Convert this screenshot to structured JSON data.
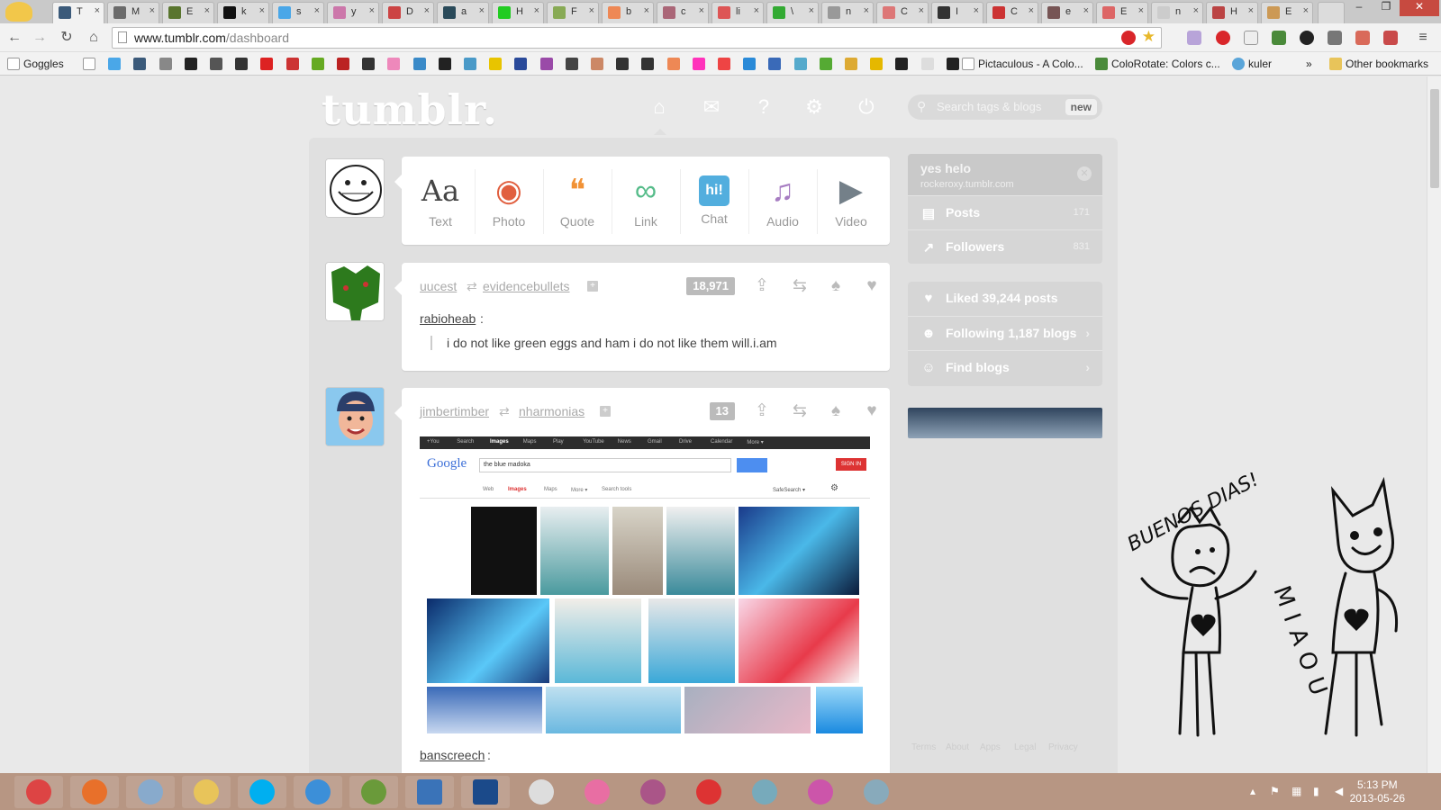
{
  "browser": {
    "tabs": [
      {
        "label": "T",
        "active": true,
        "color": "#3b5a7a"
      },
      {
        "label": "M",
        "color": "#6b6b6b"
      },
      {
        "label": "E",
        "color": "#59752e"
      },
      {
        "label": "k",
        "color": "#111"
      },
      {
        "label": "s",
        "color": "#4aa7e8"
      },
      {
        "label": "y",
        "color": "#c7a"
      },
      {
        "label": "D",
        "color": "#c44"
      },
      {
        "label": "a",
        "color": "#2a4a5a"
      },
      {
        "label": "H",
        "color": "#2c2"
      },
      {
        "label": "F",
        "color": "#8a5"
      },
      {
        "label": "b",
        "color": "#e85"
      },
      {
        "label": "c",
        "color": "#a67"
      },
      {
        "label": "li",
        "color": "#d55"
      },
      {
        "label": "\\",
        "color": "#3a3"
      },
      {
        "label": "n",
        "color": "#999"
      },
      {
        "label": "C",
        "color": "#d77"
      },
      {
        "label": "I",
        "color": "#333"
      },
      {
        "label": "C",
        "color": "#c33"
      },
      {
        "label": "e",
        "color": "#755"
      },
      {
        "label": "E",
        "color": "#d66"
      },
      {
        "label": "n",
        "color": "#ccc"
      },
      {
        "label": "H",
        "color": "#b44"
      },
      {
        "label": "E",
        "color": "#c95"
      }
    ],
    "url_host": "www.tumblr.com",
    "url_path": "/dashboard",
    "window_controls": [
      "–",
      "❐",
      "✕"
    ],
    "menu_icon": "≡",
    "bookmarks": {
      "goggles": "Goggles",
      "pictaculous": "Pictaculous - A Colo...",
      "colorotate": "ColoRotate: Colors c...",
      "kuler": "kuler",
      "more": "»",
      "other": "Other bookmarks"
    }
  },
  "tumblr": {
    "logo": "tumblr.",
    "search_placeholder": "Search tags & blogs",
    "search_new": "new",
    "post_types": [
      {
        "label": "Text",
        "icon": "Aa",
        "color": "#444"
      },
      {
        "label": "Photo",
        "icon": "◉",
        "color": "#e15f3f"
      },
      {
        "label": "Quote",
        "icon": "❝",
        "color": "#f19236"
      },
      {
        "label": "Link",
        "icon": "∞",
        "color": "#56bc8a"
      },
      {
        "label": "Chat",
        "icon": "hi!",
        "color": "#52aede"
      },
      {
        "label": "Audio",
        "icon": "♫",
        "color": "#a77dc2"
      },
      {
        "label": "Video",
        "icon": "▶",
        "color": "#748089"
      }
    ],
    "post1": {
      "user": "uucest",
      "reblogged_from": "evidencebullets",
      "notes": "18,971",
      "source": "rabioheab",
      "source_suffix": ":",
      "quote": "i do not like green eggs and ham i do not like them will.i.am"
    },
    "post2": {
      "user": "jimbertimber",
      "reblogged_from": "nharmonias",
      "notes": "13",
      "source": "banscreech",
      "source_suffix": ":",
      "google": {
        "logo": "Google",
        "query": "the blue madoka",
        "signin": "SIGN IN",
        "topbar": [
          "+You",
          "Search",
          "Images",
          "Maps",
          "Play",
          "YouTube",
          "News",
          "Gmail",
          "Drive",
          "Calendar",
          "More ▾"
        ],
        "tabs": [
          "Web",
          "Images",
          "Maps",
          "More ▾",
          "Search tools"
        ],
        "safe": "SafeSearch ▾"
      }
    },
    "sidebar": {
      "blog_title": "yes helo",
      "blog_url": "rockeroxy.tumblr.com",
      "posts_label": "Posts",
      "posts_count": "171",
      "followers_label": "Followers",
      "followers_count": "831",
      "liked": "Liked 39,244 posts",
      "following": "Following 1,187 blogs",
      "find": "Find blogs"
    },
    "footer_links": [
      "Terms",
      "About",
      "Apps",
      "Legal",
      "Privacy"
    ]
  },
  "taskbar": {
    "time": "5:13 PM",
    "date": "2013-05-26",
    "apps": [
      {
        "name": "chrome",
        "color": "#d44"
      },
      {
        "name": "firefox",
        "color": "#e8702a"
      },
      {
        "name": "paint",
        "color": "#88aacc"
      },
      {
        "name": "explorer",
        "color": "#e8c45a"
      },
      {
        "name": "skype",
        "color": "#00aff0"
      },
      {
        "name": "itunes",
        "color": "#3c8fd8"
      },
      {
        "name": "minecraft",
        "color": "#6a9a3a"
      },
      {
        "name": "photoshop-elements",
        "color": "#3a73b8"
      },
      {
        "name": "photoshop",
        "color": "#1b4a8a"
      },
      {
        "name": "notepad",
        "color": "#ddd"
      },
      {
        "name": "osu",
        "color": "#e86ea3"
      },
      {
        "name": "game-1",
        "color": "#a58"
      },
      {
        "name": "mushroom",
        "color": "#d33"
      },
      {
        "name": "game-2",
        "color": "#7ab"
      },
      {
        "name": "paint-tool",
        "color": "#c5a"
      },
      {
        "name": "control-panel",
        "color": "#8ab"
      }
    ]
  },
  "doodle": {
    "greeting": "BUENOS DIAS!",
    "sound": "MIAOU"
  }
}
